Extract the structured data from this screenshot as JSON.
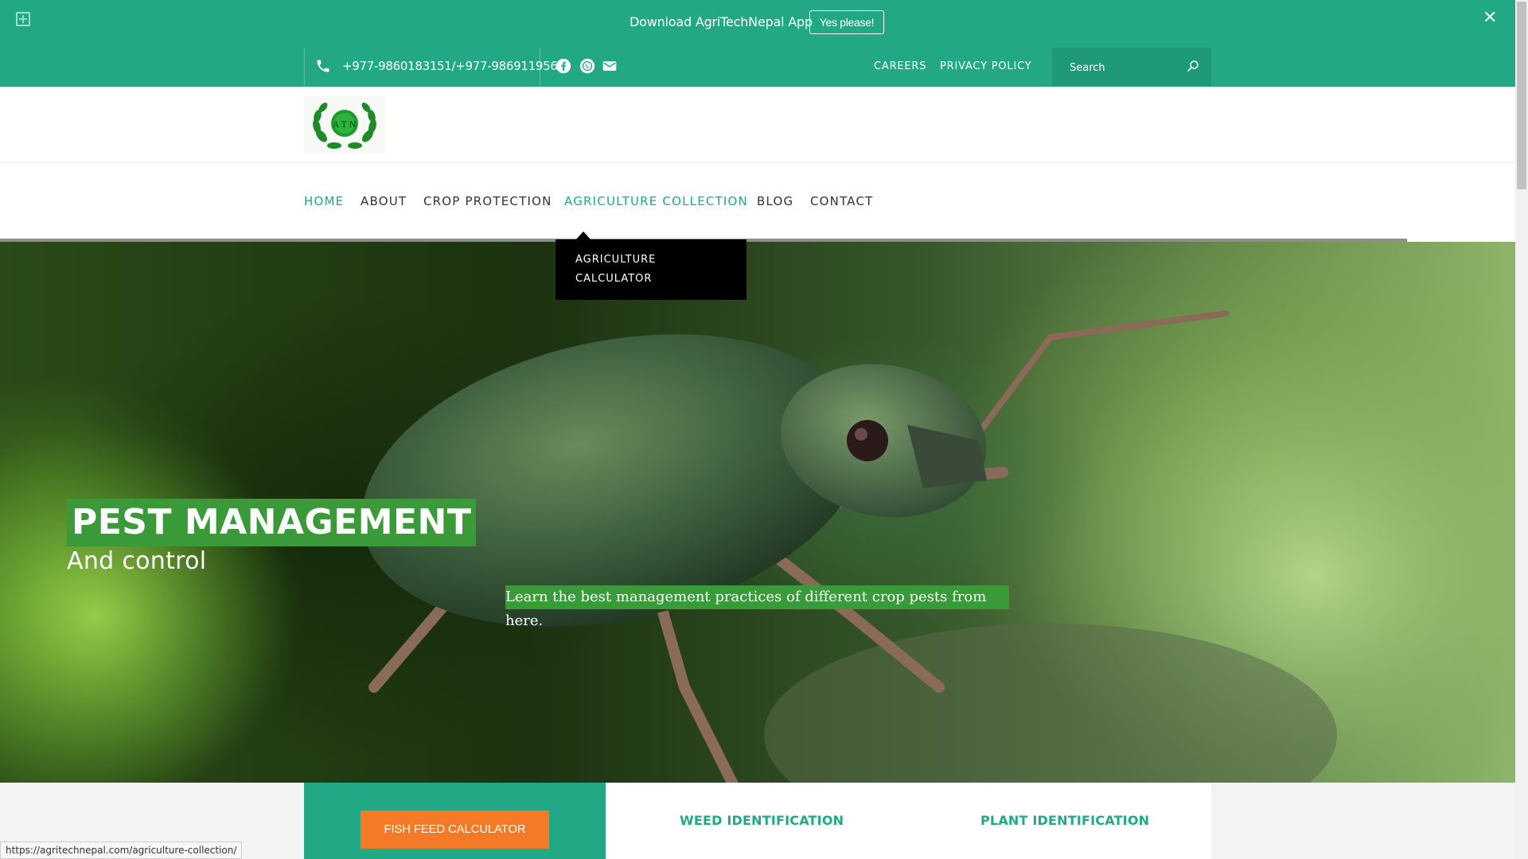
{
  "promo": {
    "text": "Download AgriTechNepal App",
    "button": "Yes please!",
    "close": "✕",
    "plus": "+"
  },
  "contact": {
    "phone": "+977-9860183151/+977-9869119568"
  },
  "top_links": {
    "careers": "CAREERS",
    "privacy": "PRIVACY POLICY"
  },
  "search": {
    "placeholder": "Search"
  },
  "logo": {
    "letters": "A T N"
  },
  "nav": {
    "items": [
      {
        "label": "HOME"
      },
      {
        "label": "ABOUT"
      },
      {
        "label": "CROP PROTECTION"
      },
      {
        "label": "AGRICULTURE COLLECTION"
      },
      {
        "label": "BLOG"
      },
      {
        "label": "CONTACT"
      }
    ],
    "dropdown": {
      "item": "AGRICULTURE CALCULATOR"
    }
  },
  "hero": {
    "title": "PEST MANAGEMENT",
    "subtitle": "And control",
    "description": "Learn the best management practices of different crop pests from here."
  },
  "bottom": {
    "fish_button": "FISH FEED CALCULATOR",
    "weed": "WEED IDENTIFICATION",
    "plant": "PLANT IDENTIFICATION"
  },
  "status": {
    "url": "https://agritechnepal.com/agriculture-collection/"
  },
  "colors": {
    "brand_green": "#22a884",
    "highlight_green": "#3a9a3a",
    "accent_orange": "#f47a28"
  },
  "icons": [
    "plus-icon",
    "close-icon",
    "phone-icon",
    "facebook-icon",
    "whatsapp-icon",
    "email-icon",
    "search-icon"
  ]
}
